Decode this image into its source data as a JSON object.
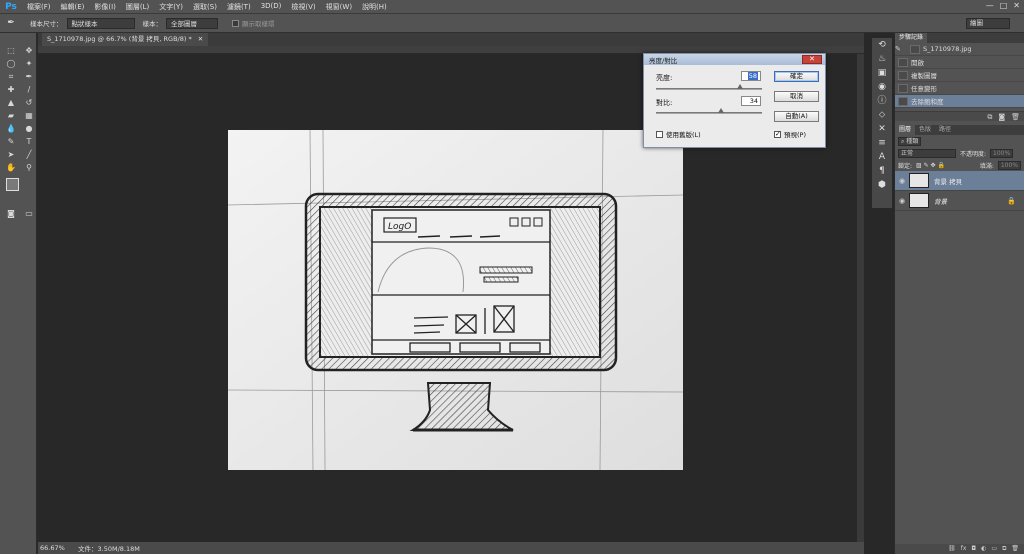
{
  "app": {
    "logo": "Ps"
  },
  "menu": [
    "檔案(F)",
    "編輯(E)",
    "影像(I)",
    "圖層(L)",
    "文字(Y)",
    "選取(S)",
    "濾鏡(T)",
    "3D(D)",
    "檢視(V)",
    "視窗(W)",
    "說明(H)"
  ],
  "window_controls": [
    "—",
    "□",
    "✕"
  ],
  "options": {
    "tool_icon": "eyedropper-icon",
    "sample_size_label": "樣本尺寸：",
    "sample_size_value": "點狀樣本",
    "sample_label": "樣本：",
    "sample_value": "全部圖層",
    "show_ring_label": "顯示取樣環",
    "workspace": "繪圖"
  },
  "document_tab": {
    "title": "S_1710978.jpg @ 66.7% (背景 拷貝, RGB/8) *",
    "close": "✕"
  },
  "status": {
    "zoom": "66.67%",
    "doc_size": "文件：3.50M/8.18M"
  },
  "dialog": {
    "title": "亮度/對比",
    "brightness_label": "亮度:",
    "brightness_value": "58",
    "brightness_level": 0.79,
    "contrast_label": "對比:",
    "contrast_value": "34",
    "contrast_level": 0.61,
    "ok_label": "確定",
    "cancel_label": "取消",
    "auto_label": "自動(A)",
    "legacy_label": "使用舊版(L)",
    "legacy_checked": false,
    "preview_label": "預視(P)",
    "preview_checked": true,
    "close_glyph": "✕"
  },
  "history": {
    "tabs": [
      "步驟記錄"
    ],
    "snapshot_name": "S_1710978.jpg",
    "items": [
      "開啟",
      "複製圖層",
      "任意變形",
      "去除飽和度"
    ],
    "active_index": 3
  },
  "layers": {
    "tabs": [
      "圖層",
      "色版",
      "路徑"
    ],
    "kind_label": "種類",
    "blend_mode": "正常",
    "opacity_label": "不透明度:",
    "opacity_value": "100%",
    "lock_label": "鎖定:",
    "fill_label": "填滿:",
    "fill_value": "100%",
    "items": [
      {
        "name": "背景 拷貝",
        "active": true,
        "locked": false
      },
      {
        "name": "背景",
        "active": false,
        "locked": true
      }
    ]
  },
  "sketch": {
    "logo_text": "LogO"
  },
  "colors": {
    "accent": "#31a8ff",
    "selection": "#6c7f98",
    "dialog_title": "#a9bcd6"
  }
}
